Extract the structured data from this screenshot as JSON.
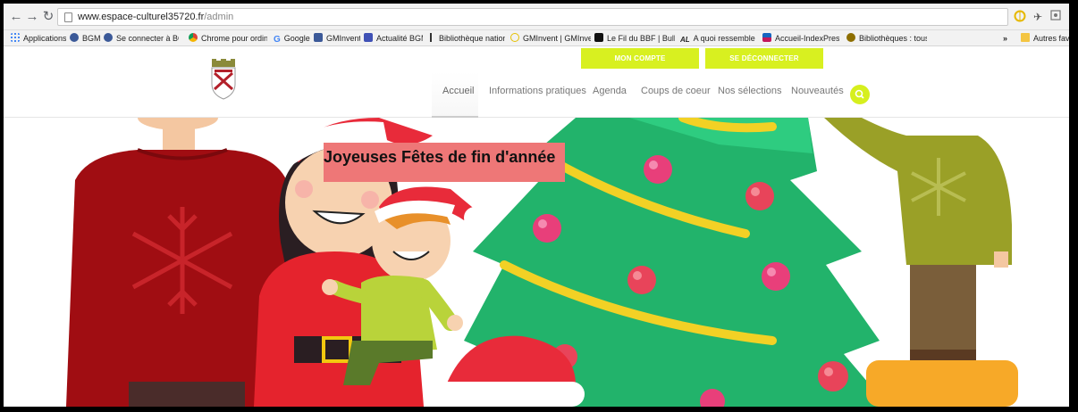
{
  "browser": {
    "url_host": "www.espace-culturel35720.fr",
    "url_path": "/admin"
  },
  "bookmarks": [
    {
      "label": "Applications",
      "color": "#4285f4"
    },
    {
      "label": "BGM",
      "color": "#3b5998"
    },
    {
      "label": "Se connecter à BGM",
      "color": "#3b5998"
    },
    {
      "label": "Chrome pour ordinat",
      "color": "#db4437"
    },
    {
      "label": "Google",
      "color": "#4285f4"
    },
    {
      "label": "GMInvent",
      "color": "#3b5998"
    },
    {
      "label": "Actualité BGM",
      "color": "#3f51b5"
    },
    {
      "label": "Bibliothèque national",
      "color": "#333333"
    },
    {
      "label": "GMInvent | GMInvent",
      "color": "#e5c000"
    },
    {
      "label": "Le Fil du BBF | Bulletin",
      "color": "#111111"
    },
    {
      "label": "A quoi ressembleront",
      "color": "#555555"
    },
    {
      "label": "Accueil-IndexPresse",
      "color": "#c2185b"
    },
    {
      "label": "Bibliothèques : tous l",
      "color": "#8d6e00"
    },
    {
      "label": "Autres favo",
      "color": "#f4c542"
    }
  ],
  "site": {
    "account_button": "MON COMPTE",
    "logout_button": "SE DÉCONNECTER",
    "menu": [
      "Accueil",
      "Informations pratiques",
      "Agenda",
      "Coups de coeur",
      "Nos sélections",
      "Nouveautés"
    ],
    "active_menu": "Accueil",
    "accent_color": "#d8f020"
  },
  "hero": {
    "banner_text": "Joyeuses Fêtes de fin d'année",
    "banner_color": "#ee7777"
  }
}
